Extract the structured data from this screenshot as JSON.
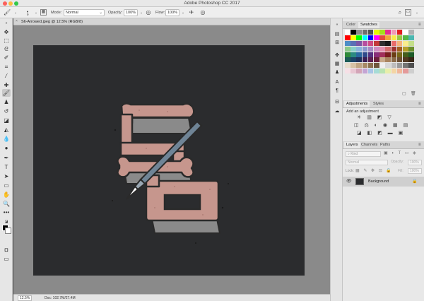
{
  "app": {
    "title": "Adobe Photoshop CC 2017"
  },
  "window_controls": {
    "close_color": "#fc605b",
    "minimize_color": "#fdbc40",
    "maximize_color": "#34c84a"
  },
  "options_bar": {
    "brush_size": "9",
    "mode_label": "Mode:",
    "mode_value": "Normal",
    "opacity_label": "Opacity:",
    "opacity_value": "100%",
    "flow_label": "Flow:",
    "flow_value": "100%"
  },
  "document": {
    "tab_title": "S6-Arrowed.jpeg @ 12.5% (RGB/8)",
    "canvas_color": "#2b2c2e",
    "artwork_colors": {
      "fill": "#c6968d",
      "outline": "#2a2a2a",
      "shadow": "#8a8a8a",
      "pen": "#6f8496"
    }
  },
  "status_bar": {
    "zoom": "12.5%",
    "doc_info": "Doc: 102.7M/27.4M"
  },
  "color_panel": {
    "tabs": [
      "Color",
      "Swatches"
    ],
    "active_tab": "Swatches",
    "swatch_rows": [
      [
        "#ffffff",
        "#000000",
        "#8c8c8c",
        "#6e6e6e",
        "#505050",
        "#eaf600",
        "#a4e01b",
        "#e62c8e",
        "#f19ab7",
        "#e01e1e",
        "#ffffff",
        "#b0b0b0"
      ],
      [
        "#ff0000",
        "#ffff00",
        "#00ff00",
        "#00ffff",
        "#0000ff",
        "#ff00ff",
        "#e34b3c",
        "#f2a33a",
        "#f7ec4a",
        "#98c847",
        "#55b848",
        "#4bb7b0"
      ],
      [
        "#4e8ec7",
        "#5b6fb5",
        "#7b56a6",
        "#b64fa0",
        "#d04c84",
        "#c33b3b",
        "#2f2f2f",
        "#1a1a1a",
        "#e86c6c",
        "#f4b37a",
        "#f9ec8d",
        "#c5df8a"
      ],
      [
        "#8dc98a",
        "#89cfc8",
        "#8ab3dd",
        "#8b98cf",
        "#a58ac4",
        "#d08cc1",
        "#e38fae",
        "#d36b6b",
        "#9e3131",
        "#a35e20",
        "#b59f2a",
        "#6a8e2c"
      ],
      [
        "#2f8a3b",
        "#2b8a82",
        "#2a68a0",
        "#2f4a8b",
        "#54327f",
        "#8a2f7a",
        "#a02f5a",
        "#7a1e1e",
        "#6b3d14",
        "#786617",
        "#465e1c",
        "#1e5b28"
      ],
      [
        "#1d5c57",
        "#1b4468",
        "#1f305b",
        "#381f55",
        "#5c1f51",
        "#6b1f3b",
        "#c8a98a",
        "#a8845f",
        "#8a6a48",
        "#6c4f33",
        "#523a24",
        "#3a2818"
      ],
      [
        "#e8dccb",
        "#d5c2a6",
        "#bfa584",
        "#a78a66",
        "#8c704f",
        "#70583d",
        "#f0f0f0",
        "#d8d8d8",
        "#bdbdbd",
        "#9a9a9a",
        "#757575",
        "#4f4f4f"
      ],
      [
        "#f6e0e6",
        "#e8c6d2",
        "#d3a4b7",
        "#c4a4d4",
        "#a9c4e6",
        "#a6dbd6",
        "#b9e3b1",
        "#e8eeaa",
        "#f4d5a4",
        "#f0b79a",
        "#e49a9a",
        "#cfcfcf"
      ]
    ]
  },
  "adjustments_panel": {
    "tabs": [
      "Adjustments",
      "Styles"
    ],
    "active_tab": "Adjustments",
    "add_label": "Add an adjustment",
    "row1": "☀ ▥ ◩ ▽",
    "row2": "◫ ⚖ ◐ ◉ ▦ ▤",
    "row3": "◪ ◧ ◩ ▬ ▣"
  },
  "layers_panel": {
    "tabs": [
      "Layers",
      "Channels",
      "Paths"
    ],
    "active_tab": "Layers",
    "kind_placeholder": "Kind",
    "blend_mode": "Normal",
    "opacity_label": "Opacity:",
    "opacity_value": "100%",
    "lock_label": "Lock:",
    "fill_label": "Fill:",
    "fill_value": "100%",
    "layers": [
      {
        "name": "Background",
        "visible": true,
        "locked": true
      }
    ]
  }
}
